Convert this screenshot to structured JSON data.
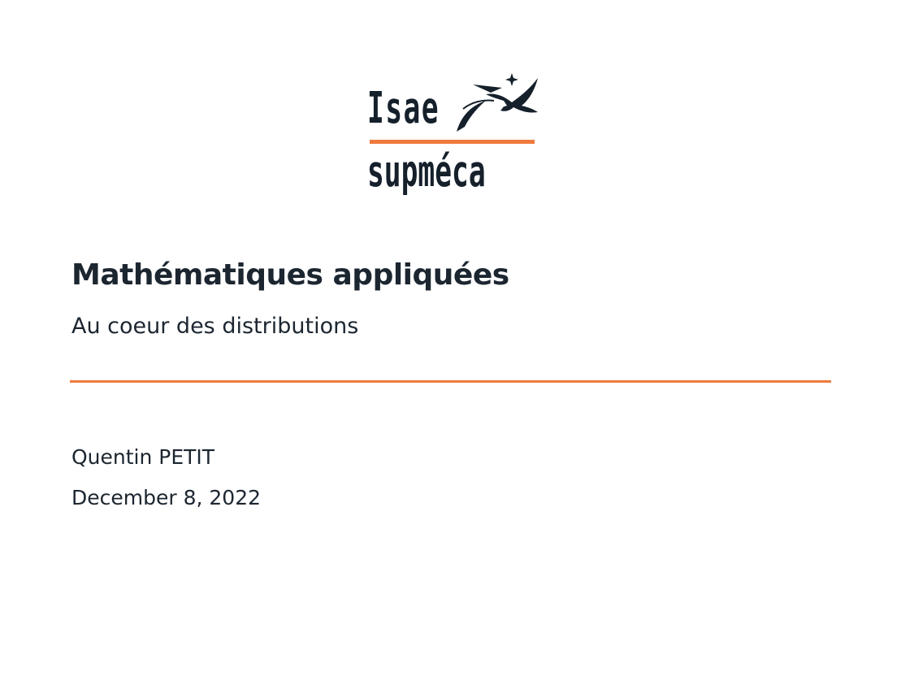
{
  "logo": {
    "line1": "Isae",
    "line2": "supméca",
    "icon": "bird-icon",
    "accent_color": "#ef7a3d",
    "text_color": "#15202b"
  },
  "slide": {
    "title": "Mathématiques appliquées",
    "subtitle": "Au coeur des distributions",
    "author": "Quentin PETIT",
    "date": "December 8, 2022",
    "rule_color": "#ef7a3d"
  }
}
